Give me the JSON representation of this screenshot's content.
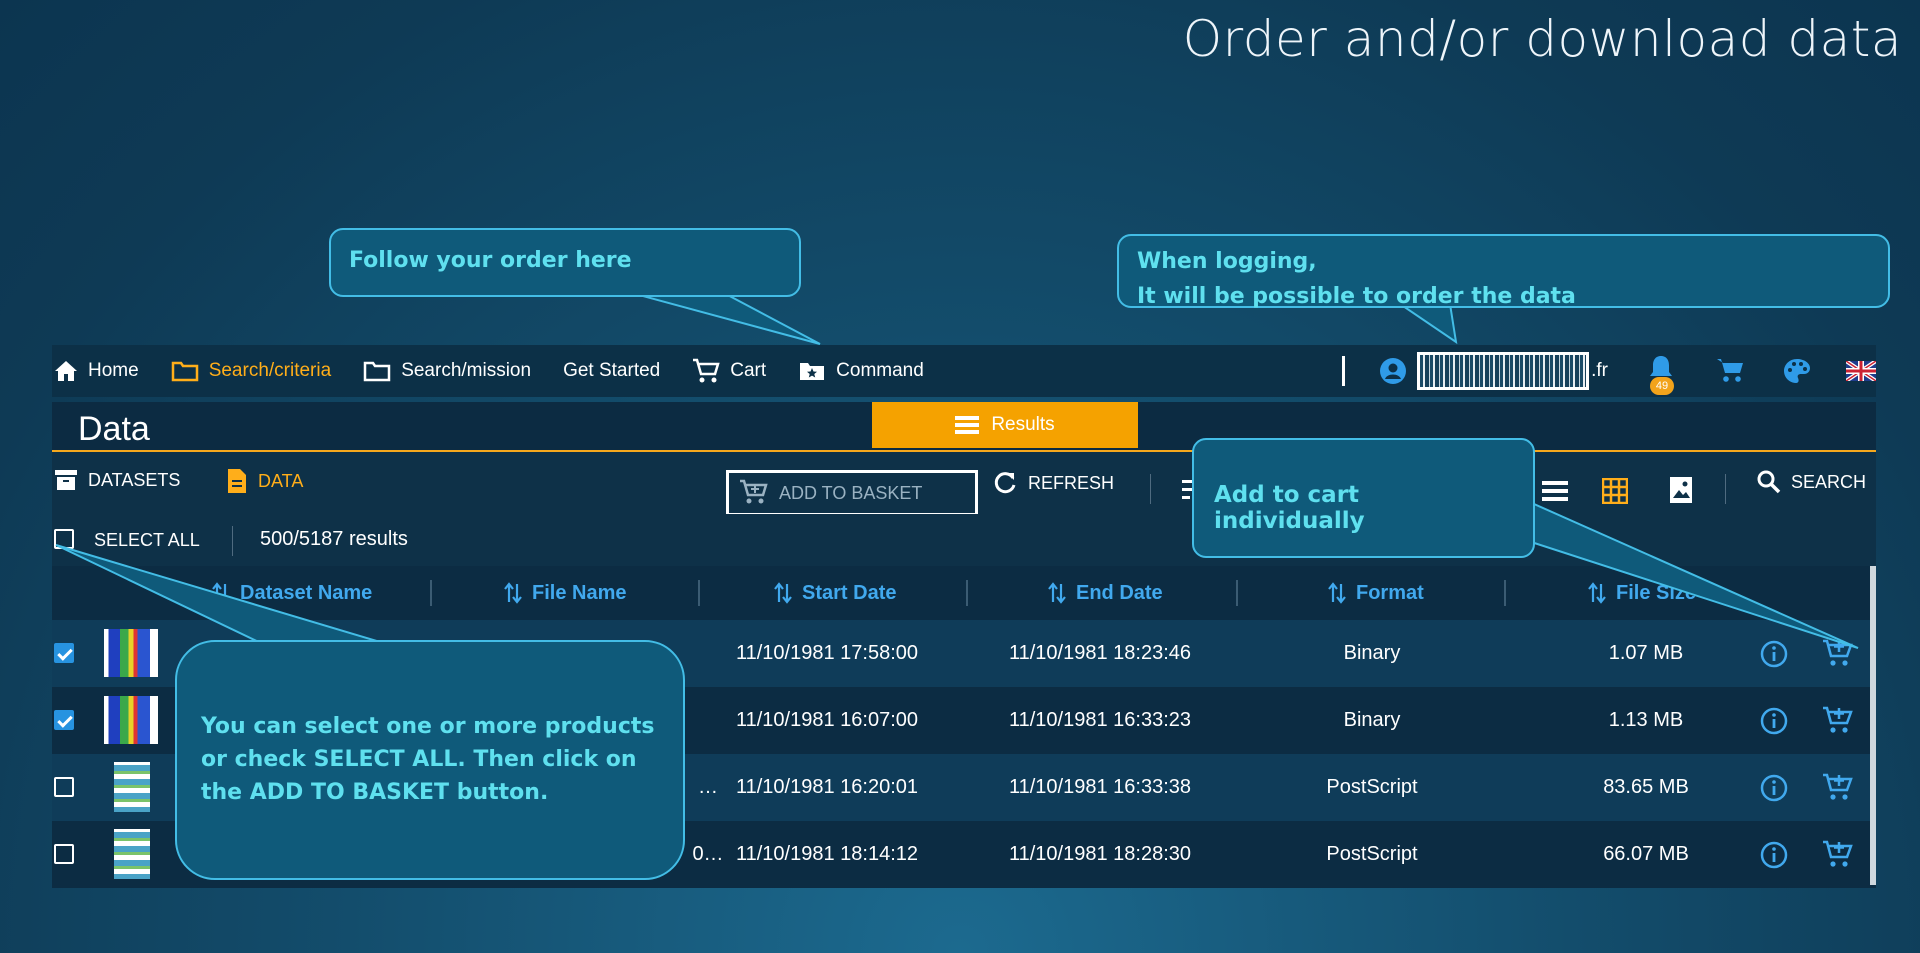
{
  "slide": {
    "title": "Order and/or download data"
  },
  "navbar": {
    "items": [
      {
        "label": "Home",
        "icon": "home-icon"
      },
      {
        "label": "Search/criteria",
        "icon": "folder-icon",
        "active": true
      },
      {
        "label": "Search/mission",
        "icon": "folder-outline-icon"
      },
      {
        "label": "Get Started"
      },
      {
        "label": "Cart",
        "icon": "cart-icon"
      },
      {
        "label": "Command",
        "icon": "folder-star-icon"
      }
    ],
    "user_suffix": ".fr",
    "notification_count": "49"
  },
  "header": {
    "title": "Data",
    "tab_results": "Results"
  },
  "toolbar": {
    "datasets": "DATASETS",
    "data": "DATA",
    "add_to_basket": "ADD TO BASKET",
    "refresh": "REFRESH",
    "search": "SEARCH"
  },
  "selection": {
    "select_all": "SELECT ALL",
    "results_count": "500/5187 results"
  },
  "table": {
    "columns": [
      "Dataset Name",
      "File Name",
      "Start Date",
      "End Date",
      "Format",
      "File Size"
    ],
    "rows": [
      {
        "checked": true,
        "suffix": "",
        "start": "11/10/1981 17:58:00",
        "end": "11/10/1981 18:23:46",
        "format": "Binary",
        "size": "1.07 MB"
      },
      {
        "checked": true,
        "suffix": "",
        "start": "11/10/1981 16:07:00",
        "end": "11/10/1981 16:33:23",
        "format": "Binary",
        "size": "1.13 MB"
      },
      {
        "checked": false,
        "suffix": "…",
        "start": "11/10/1981 16:20:01",
        "end": "11/10/1981 16:33:38",
        "format": "PostScript",
        "size": "83.65 MB"
      },
      {
        "checked": false,
        "suffix": "0…",
        "start": "11/10/1981 18:14:12",
        "end": "11/10/1981 18:28:30",
        "format": "PostScript",
        "size": "66.07 MB"
      }
    ]
  },
  "callouts": {
    "order": "Follow your order here",
    "login": "When logging,\nIt will be possible to order the data",
    "cart": "Add to cart individually",
    "select": "You can select one or more products\nor check SELECT ALL. Then click on\nthe ADD TO BASKET button."
  },
  "colors": {
    "accent": "#f5a200",
    "link": "#41a9ee",
    "callout_text": "#5fe0ef"
  }
}
